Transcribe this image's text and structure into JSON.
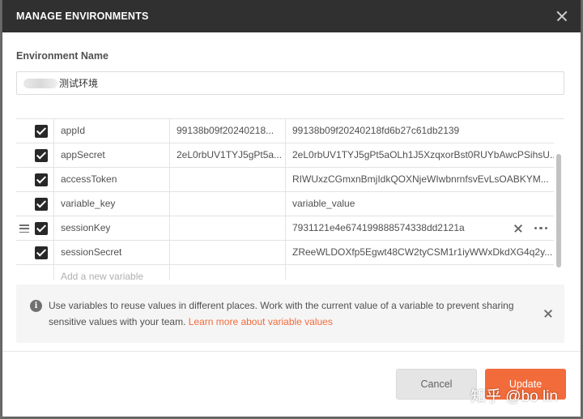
{
  "modal": {
    "title": "MANAGE ENVIRONMENTS"
  },
  "environment": {
    "label": "Environment Name",
    "value": "测试环境"
  },
  "variables": [
    {
      "key": "appId",
      "initial": "99138b09f20240218...",
      "current": "99138b09f20240218fd6b27c61db2139",
      "enabled": true
    },
    {
      "key": "appSecret",
      "initial": "2eL0rbUV1TYJ5gPt5a...",
      "current": "2eL0rbUV1TYJ5gPt5aOLh1J5XzqxorBst0RUYbAwcPSihsU...",
      "enabled": true
    },
    {
      "key": "accessToken",
      "initial": "",
      "current": "RIWUxzCGmxnBmjIdkQOXNjeWIwbnrnfsvEvLsOABKYM...",
      "enabled": true
    },
    {
      "key": "variable_key",
      "initial": "",
      "current": "variable_value",
      "enabled": true
    },
    {
      "key": "sessionKey",
      "initial": "",
      "current": "7931121e4e674199888574338dd2121a",
      "enabled": true
    },
    {
      "key": "sessionSecret",
      "initial": "",
      "current": "ZReeWLDOXfp5Egwt48CW2tyCSM1r1iyWWxDkdXG4q2y...",
      "enabled": true
    }
  ],
  "new_variable_placeholder": "Add a new variable",
  "info": {
    "text": "Use variables to reuse values in different places. Work with the current value of a variable to prevent sharing sensitive values with your team.",
    "link": "Learn more about variable values"
  },
  "buttons": {
    "cancel": "Cancel",
    "update": "Update"
  },
  "watermark": "知乎 @bo lin",
  "colors": {
    "header_bg": "#303030",
    "accent": "#f26b3a",
    "checkbox": "#282828"
  }
}
